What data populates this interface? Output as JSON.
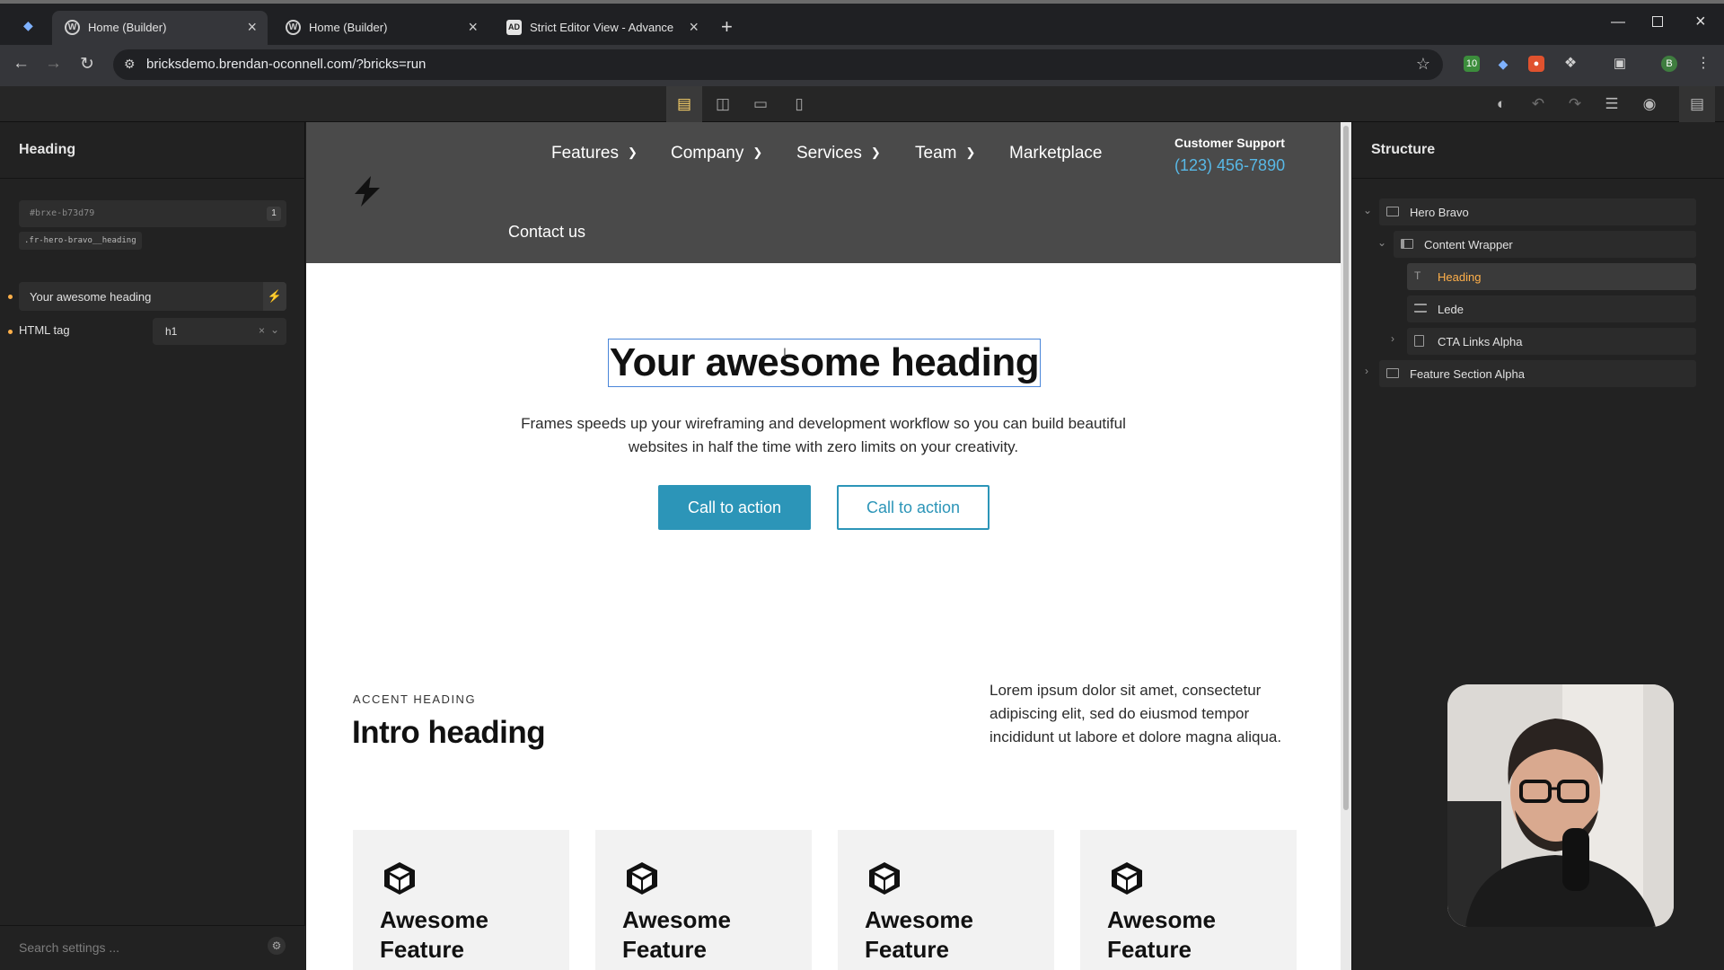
{
  "browser": {
    "tabs": [
      {
        "title": "Home (Builder)",
        "icon": "wordpress-icon"
      },
      {
        "title": "Home (Builder)",
        "icon": "wordpress-icon"
      },
      {
        "title": "Strict Editor View - Advanced T",
        "icon": "ad-icon",
        "icon_text": "AD"
      }
    ],
    "url": "bricksdemo.brendan-oconnell.com/?bricks=run",
    "profile_initial": "B",
    "extension_badge": "10"
  },
  "left_panel": {
    "title": "Heading",
    "element_id": "#brxe-b73d79",
    "class_count": "1",
    "class_name": ".fr-hero-bravo__heading",
    "text_value": "Your awesome heading",
    "html_tag_label": "HTML tag",
    "html_tag_value": "h1",
    "search_placeholder": "Search settings ..."
  },
  "site": {
    "nav": [
      {
        "label": "Features",
        "has_dropdown": true
      },
      {
        "label": "Company",
        "has_dropdown": true
      },
      {
        "label": "Services",
        "has_dropdown": true
      },
      {
        "label": "Team",
        "has_dropdown": true
      },
      {
        "label": "Marketplace",
        "has_dropdown": false
      },
      {
        "label": "Contact us",
        "has_dropdown": false
      }
    ],
    "support_label": "Customer Support",
    "support_phone": "(123) 456-7890",
    "hero_heading": "Your awesome heading",
    "hero_lede_line1": "Frames speeds up your wireframing and development workflow so you can build beautiful",
    "hero_lede_line2": "websites in half the time with zero limits on your creativity.",
    "cta_primary": "Call to action",
    "cta_secondary": "Call to action",
    "accent_heading": "ACCENT HEADING",
    "intro_heading": "Intro heading",
    "intro_text": "Lorem ipsum dolor sit amet, consectetur adipiscing elit, sed do eiusmod tempor incididunt ut labore et dolore magna aliqua.",
    "feature_cards": [
      {
        "line1": "Awesome",
        "line2": "Feature"
      },
      {
        "line1": "Awesome",
        "line2": "Feature"
      },
      {
        "line1": "Awesome",
        "line2": "Feature"
      },
      {
        "line1": "Awesome",
        "line2": "Feature"
      }
    ],
    "accent_color": "#2c95b8",
    "header_color": "#4a4a4a"
  },
  "structure": {
    "title": "Structure",
    "items": [
      {
        "name": "Hero Bravo",
        "icon": "section-icon"
      },
      {
        "name": "Content Wrapper",
        "icon": "container-icon"
      },
      {
        "name": "Heading",
        "icon": "text-icon",
        "selected": true
      },
      {
        "name": "Lede",
        "icon": "paragraph-icon"
      },
      {
        "name": "CTA Links Alpha",
        "icon": "block-icon"
      },
      {
        "name": "Feature Section Alpha",
        "icon": "section-icon"
      }
    ]
  }
}
